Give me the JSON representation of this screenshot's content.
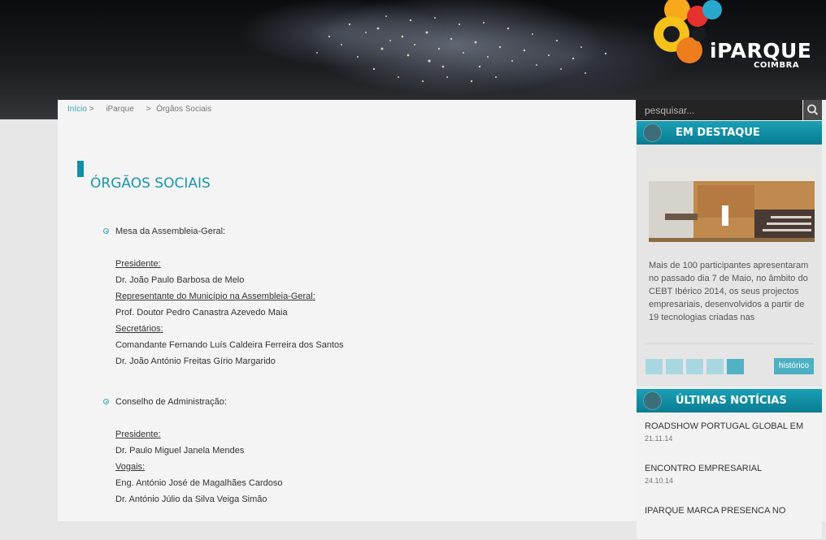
{
  "logo": {
    "name": "iPARQUE",
    "city": "COIMBRA"
  },
  "breadcrumb": {
    "home": "Início",
    "sep1": ">",
    "parent": "iParque",
    "sep2": ">",
    "current": "Órgãos Sociais"
  },
  "page_title": "ÓRGÃOS SOCIAIS",
  "sections": [
    {
      "heading": "Mesa da Assembleia-Geral:",
      "lines": [
        {
          "text": "Presidente:",
          "underline": true
        },
        {
          "text": "Dr. João Paulo Barbosa de Melo",
          "underline": false
        },
        {
          "text": "Representante do Município na Assembleia-Geral:",
          "underline": true
        },
        {
          "text": "Prof. Doutor Pedro Canastra Azevedo Maia",
          "underline": false
        },
        {
          "text": "Secretários:",
          "underline": true
        },
        {
          "text": "Comandante Fernando Luís Caldeira Ferreira dos Santos",
          "underline": false
        },
        {
          "text": "Dr. João António Freitas Gírio Margarido",
          "underline": false
        }
      ]
    },
    {
      "heading": "Conselho de Administração:",
      "lines": [
        {
          "text": "Presidente:",
          "underline": true
        },
        {
          "text": "Dr. Paulo Miguel Janela Mendes",
          "underline": false
        },
        {
          "text": "Vogais:",
          "underline": true
        },
        {
          "text": "Eng. António José de Magalhães Cardoso",
          "underline": false
        },
        {
          "text": "Dr. António Júlio da Silva Veiga Simão",
          "underline": false
        }
      ]
    }
  ],
  "search": {
    "placeholder": "pesquisar..."
  },
  "destaque": {
    "title": "EM DESTAQUE",
    "text": "Mais de 100 participantes apresentaram no passado dia 7 de Maio, no âmbito do CEBT Ibérico 2014, os seus projectos empresariais, desenvolvidos a partir de 19 tecnologias criadas nas",
    "pages": 5,
    "active_page": 5,
    "history_label": "histórico"
  },
  "news": {
    "title": "ÚLTIMAS NOTÍCIAS",
    "items": [
      {
        "title": "ROADSHOW PORTUGAL GLOBAL EM",
        "date": "21.11.14"
      },
      {
        "title": "ENCONTRO EMPRESARIAL",
        "date": "24.10.14"
      },
      {
        "title": "IPARQUE MARCA PRESENCA NO",
        "date": ""
      }
    ]
  },
  "colors": {
    "accent": "#1796ad",
    "header_bar": "#0a7c92",
    "button": "#4db0c2"
  },
  "icons": [
    "search-icon",
    "globe-icon",
    "bullet-icon"
  ]
}
